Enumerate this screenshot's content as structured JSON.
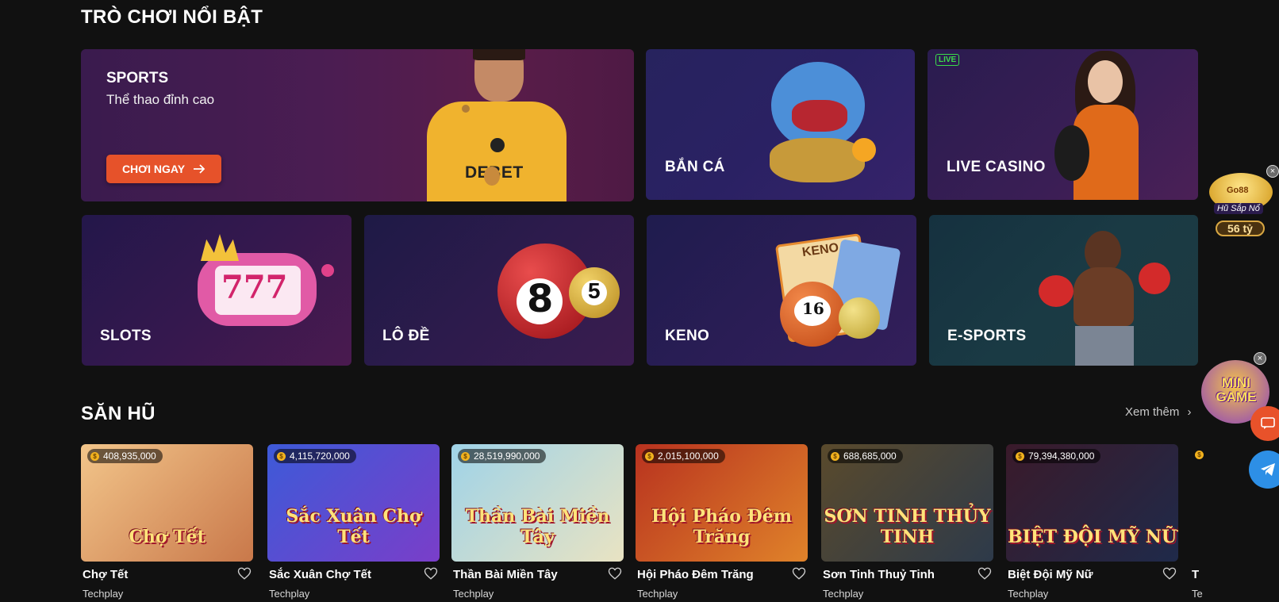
{
  "featured": {
    "title": "TRÒ CHƠI NỔI BẬT",
    "sports": {
      "title": "SPORTS",
      "subtitle": "Thể thao đỉnh cao",
      "cta": "CHƠI NGAY",
      "jersey_text": "DEBET"
    },
    "cards": [
      {
        "label": "BẮN CÁ"
      },
      {
        "label": "LIVE CASINO",
        "badge": "LIVE"
      },
      {
        "label": "SLOTS"
      },
      {
        "label": "LÔ ĐỀ"
      },
      {
        "label": "KENO"
      },
      {
        "label": "E-SPORTS"
      }
    ]
  },
  "jackpot_section": {
    "title": "SĂN HŨ",
    "see_more": "Xem thêm"
  },
  "games": [
    {
      "name": "Chợ Tết",
      "provider": "Techplay",
      "jackpot": "408,935,000",
      "art": "Chợ Tết",
      "colors": [
        "#f2c58a",
        "#c9784a"
      ]
    },
    {
      "name": "Sắc Xuân Chợ Tết",
      "provider": "Techplay",
      "jackpot": "4,115,720,000",
      "art": "Sắc Xuân Chợ Tết",
      "colors": [
        "#3d5ad8",
        "#7a3ec9"
      ]
    },
    {
      "name": "Thần Bài Miền Tây",
      "provider": "Techplay",
      "jackpot": "28,519,990,000",
      "art": "Thần Bài Miền Tây",
      "colors": [
        "#9fd3e8",
        "#e9e3c2"
      ]
    },
    {
      "name": "Hội Pháo Đêm Trăng",
      "provider": "Techplay",
      "jackpot": "2,015,100,000",
      "art": "Hội Pháo Đêm Trăng",
      "colors": [
        "#b8321f",
        "#e0832a"
      ]
    },
    {
      "name": "Sơn Tinh Thuỷ Tinh",
      "provider": "Techplay",
      "jackpot": "688,685,000",
      "art": "SƠN TINH THỦY TINH",
      "colors": [
        "#5a4a2c",
        "#2d3a4a"
      ]
    },
    {
      "name": "Biệt Đội Mỹ Nữ",
      "provider": "Techplay",
      "jackpot": "79,394,380,000",
      "art": "BIỆT ĐỘI MỸ NỮ",
      "colors": [
        "#3a1a2a",
        "#1f2a4a"
      ]
    }
  ],
  "floating": {
    "jar_label": "Hũ Sắp Nổ",
    "jar_amount": "56 tỷ",
    "jar_brand": "Go88",
    "mini_game": "MINI GAME"
  },
  "colors": {
    "background": "#111111",
    "cta": "#e6522a",
    "live": "#3bdc4a",
    "jackpot_coin": "#f2b21e"
  }
}
